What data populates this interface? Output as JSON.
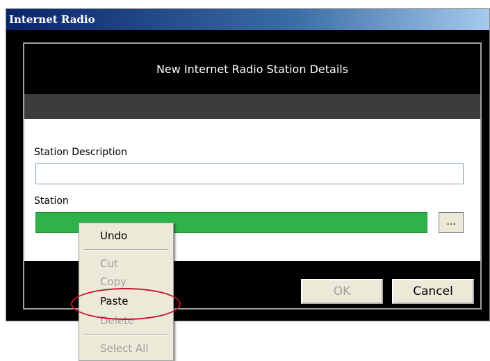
{
  "window": {
    "title": "Internet Radio"
  },
  "dialog": {
    "heading": "New Internet Radio Station Details",
    "station_description": {
      "label": "Station Description",
      "value": ""
    },
    "station": {
      "label": "Station",
      "value": ""
    },
    "browse_label": "...",
    "ok_label": "OK",
    "cancel_label": "Cancel"
  },
  "context_menu": {
    "items": [
      {
        "label": "Undo",
        "enabled": true
      },
      {
        "label": "Cut",
        "enabled": false
      },
      {
        "label": "Copy",
        "enabled": false
      },
      {
        "label": "Paste",
        "enabled": true,
        "highlighted_by_annotation": true
      },
      {
        "label": "Delete",
        "enabled": false
      },
      {
        "label": "Select All",
        "enabled": false
      }
    ]
  },
  "colors": {
    "station_field": "#2fb24a",
    "annotation": "#c8102e",
    "titlebar": "#0a246a"
  }
}
